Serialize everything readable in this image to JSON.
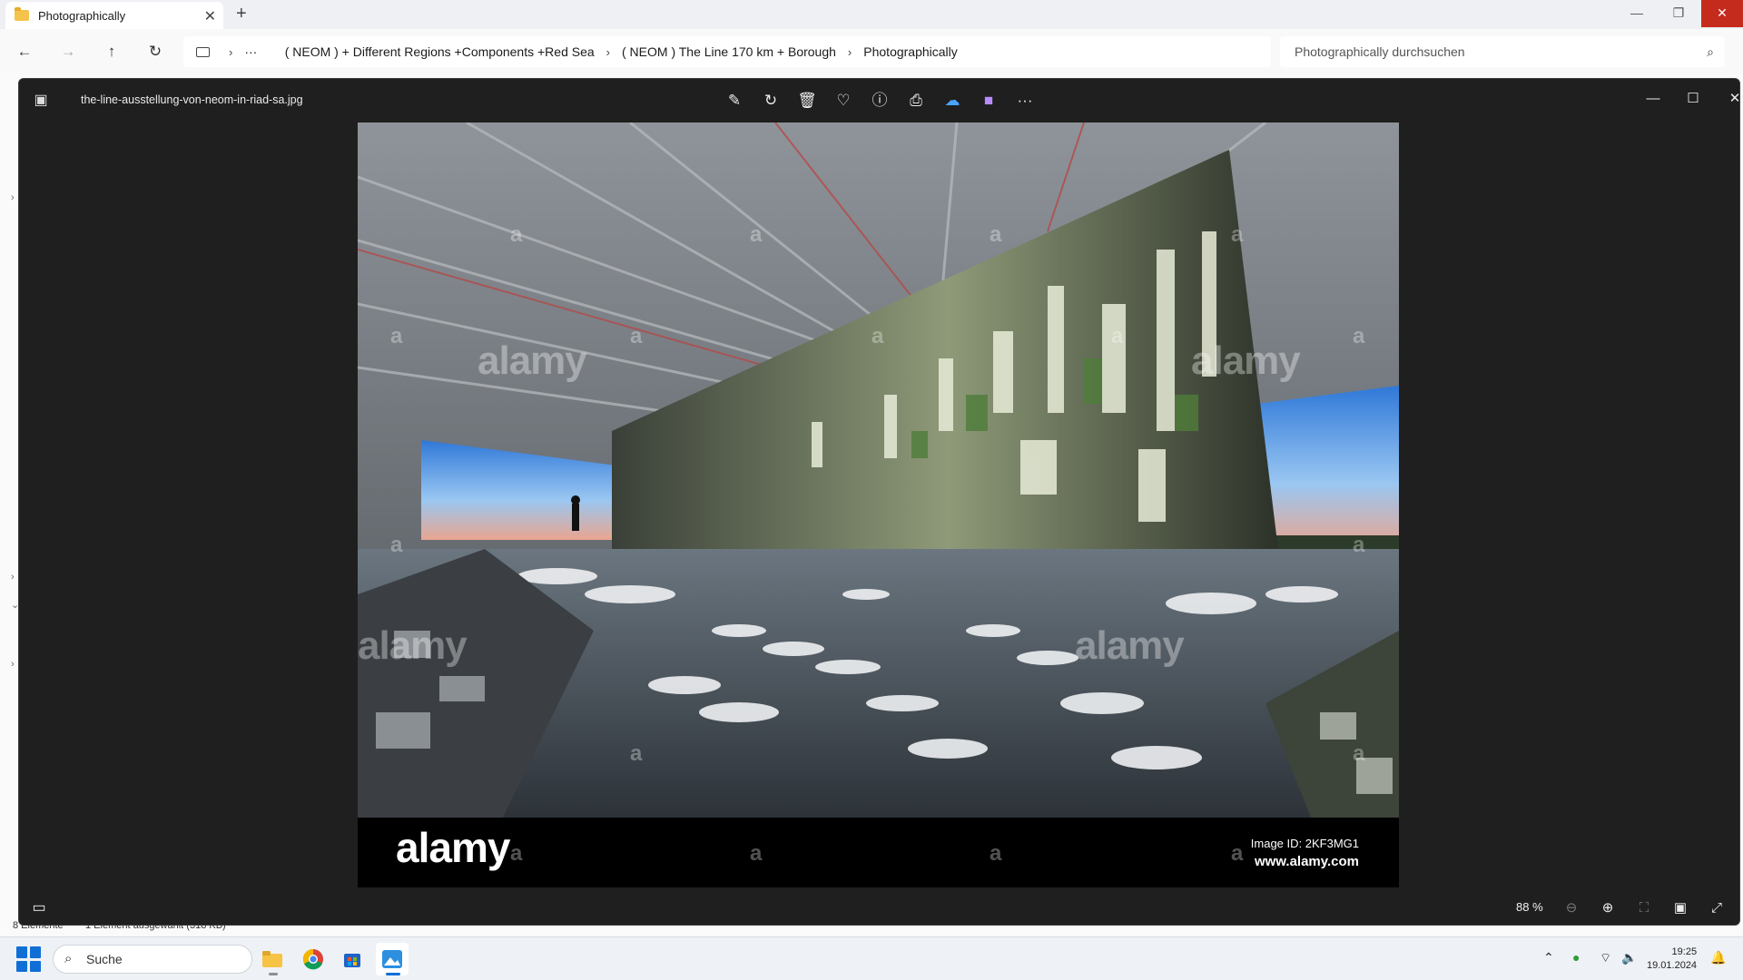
{
  "explorer": {
    "tab_title": "Photographically",
    "breadcrumbs": [
      "( NEOM ) + Different Regions +Components +Red Sea",
      "( NEOM ) The Line 170 km + Borough",
      "Photographically"
    ],
    "overflow_label": "···",
    "search_placeholder": "Photographically durchsuchen",
    "status_count": "8 Elemente",
    "status_selected": "1 Element ausgewählt (318 KB)"
  },
  "viewer": {
    "file_name": "the-line-ausstellung-von-neom-in-riad-sa.jpg",
    "zoom": "88 %",
    "watermark": {
      "logo": "alamy",
      "image_id": "Image ID: 2KF3MG1",
      "url": "www.alamy.com",
      "mark_small": "a",
      "mark_big": "alamy"
    }
  },
  "taskbar": {
    "search_label": "Suche",
    "time": "19:25",
    "date": "19.01.2024"
  },
  "icons": {
    "back": "arrow-left-icon",
    "forward": "arrow-right-icon",
    "up": "arrow-up-icon",
    "refresh": "refresh-icon",
    "edit": "edit-image-icon",
    "rotate": "rotate-icon",
    "delete": "trash-icon",
    "favorite": "heart-icon",
    "info": "info-icon",
    "print": "printer-icon",
    "onedrive": "onedrive-icon",
    "clipchamp": "clipchamp-icon",
    "more": "more-icon"
  },
  "colors": {
    "viewer_bg": "#1f1f1f",
    "close_red": "#c42b1c",
    "accent": "#0f6fd6"
  }
}
